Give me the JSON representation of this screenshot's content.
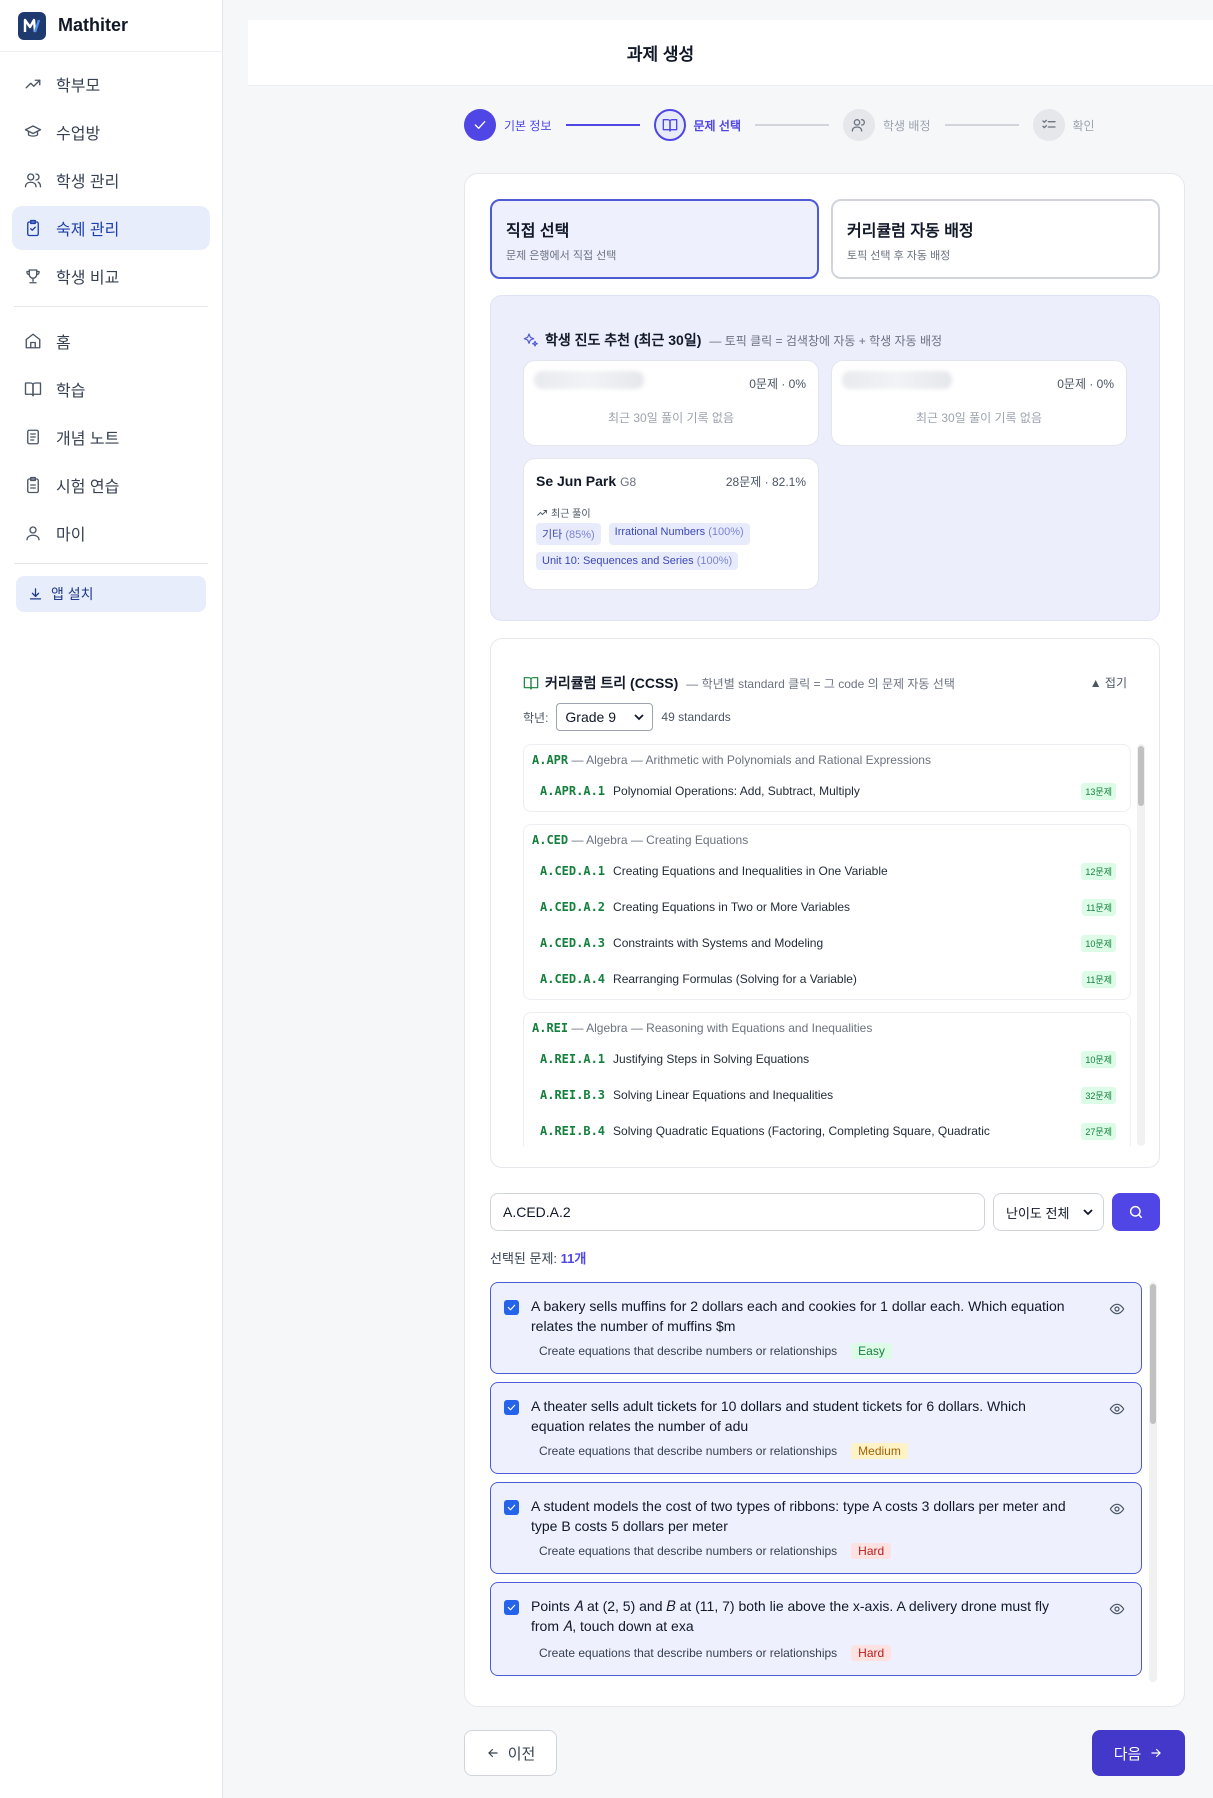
{
  "brand": {
    "name": "Mathiter"
  },
  "sidebar": {
    "items": [
      {
        "label": "학부모"
      },
      {
        "label": "수업방"
      },
      {
        "label": "학생 관리"
      },
      {
        "label": "숙제 관리"
      },
      {
        "label": "학생 비교"
      },
      {
        "label": "홈"
      },
      {
        "label": "학습"
      },
      {
        "label": "개념 노트"
      },
      {
        "label": "시험 연습"
      },
      {
        "label": "마이"
      }
    ],
    "install_label": "앱 설치"
  },
  "header": {
    "title": "과제 생성"
  },
  "steps": [
    {
      "label": "기본 정보",
      "state": "done"
    },
    {
      "label": "문제 선택",
      "state": "current"
    },
    {
      "label": "학생 배정",
      "state": "upcoming"
    },
    {
      "label": "확인",
      "state": "upcoming"
    }
  ],
  "modes": [
    {
      "title": "직접 선택",
      "sub": "문제 은행에서 직접 선택"
    },
    {
      "title": "커리큘럼 자동 배정",
      "sub": "토픽 선택 후 자동 배정"
    }
  ],
  "recommend": {
    "title": "학생 진도 추천 (최근 30일)",
    "desc": "— 토픽 클릭 = 검색창에 자동 + 학생 자동 배정",
    "students": [
      {
        "stat": "0문제 · 0%",
        "empty": "최근 30일 풀이 기록 없음"
      },
      {
        "stat": "0문제 · 0%",
        "empty": "최근 30일 풀이 기록 없음"
      },
      {
        "name": "Se Jun Park",
        "grade": "G8",
        "stat": "28문제 · 82.1%",
        "recent_label": "최근 풀이",
        "tags": [
          {
            "name": "기타",
            "pct": "(85%)"
          },
          {
            "name": "Irrational Numbers",
            "pct": "(100%)"
          },
          {
            "name": "Unit 10: Sequences and Series",
            "pct": "(100%)"
          }
        ]
      }
    ]
  },
  "tree": {
    "title": "커리큘럼 트리 (CCSS)",
    "desc": "— 학년별 standard 클릭 = 그 code 의 문제 자동 선택",
    "collapse": "▲ 접기",
    "grade_label": "학년:",
    "grade_value": "Grade 9",
    "std_count": "49 standards",
    "groups": [
      {
        "code": "A.APR",
        "desc": "— Algebra — Arithmetic with Polynomials and Rational Expressions",
        "items": [
          {
            "code": "A.APR.A.1",
            "name": "Polynomial Operations: Add, Subtract, Multiply",
            "count": "13문제"
          }
        ]
      },
      {
        "code": "A.CED",
        "desc": "— Algebra — Creating Equations",
        "items": [
          {
            "code": "A.CED.A.1",
            "name": "Creating Equations and Inequalities in One Variable",
            "count": "12문제"
          },
          {
            "code": "A.CED.A.2",
            "name": "Creating Equations in Two or More Variables",
            "count": "11문제"
          },
          {
            "code": "A.CED.A.3",
            "name": "Constraints with Systems and Modeling",
            "count": "10문제"
          },
          {
            "code": "A.CED.A.4",
            "name": "Rearranging Formulas (Solving for a Variable)",
            "count": "11문제"
          }
        ]
      },
      {
        "code": "A.REI",
        "desc": "— Algebra — Reasoning with Equations and Inequalities",
        "items": [
          {
            "code": "A.REI.A.1",
            "name": "Justifying Steps in Solving Equations",
            "count": "10문제"
          },
          {
            "code": "A.REI.B.3",
            "name": "Solving Linear Equations and Inequalities",
            "count": "32문제"
          },
          {
            "code": "A.REI.B.4",
            "name": "Solving Quadratic Equations (Factoring, Completing Square, Quadratic",
            "count": "27문제"
          }
        ]
      }
    ]
  },
  "search": {
    "value": "A.CED.A.2",
    "difficulty": "난이도 전체"
  },
  "selected": {
    "label": "선택된 문제:",
    "count": "11개"
  },
  "questions": [
    {
      "text": "A bakery sells muffins for 2 dollars each and cookies for 1 dollar each. Which equation relates the number of muffins $m",
      "topic": "Create equations that describe numbers or relationships",
      "difficulty": "Easy",
      "level": "easy"
    },
    {
      "text": "A theater sells adult tickets for 10 dollars and student tickets for 6 dollars. Which equation relates the number of adu",
      "topic": "Create equations that describe numbers or relationships",
      "difficulty": "Medium",
      "level": "medium"
    },
    {
      "text": "A student models the cost of two types of ribbons: type A costs 3 dollars per meter and type B costs 5 dollars per meter",
      "topic": "Create equations that describe numbers or relationships",
      "difficulty": "Hard",
      "level": "hard"
    },
    {
      "text": "Points 𝐴 at (2, 5) and 𝐵 at (11, 7) both lie above the x-axis. A delivery drone must fly from 𝐴, touch down at exa",
      "topic": "Create equations that describe numbers or relationships",
      "difficulty": "Hard",
      "level": "hard"
    }
  ],
  "footer": {
    "prev": "이전",
    "next": "다음"
  }
}
